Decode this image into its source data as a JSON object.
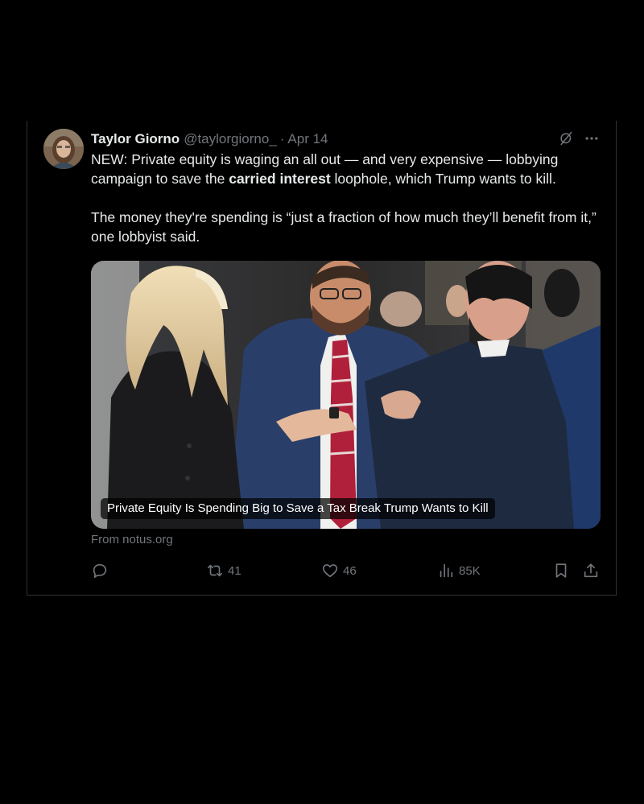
{
  "tweet": {
    "author": {
      "name": "Taylor Giorno",
      "handle": "@taylorgiorno_",
      "separator": "·",
      "date": "Apr 14"
    },
    "text": {
      "p1_a": "NEW: Private equity is waging an all out — and very expensive — lobbying campaign to save the ",
      "p1_bold": "carried interest",
      "p1_b": " loophole, which Trump wants to kill.",
      "p2": "The money they're spending is “just a fraction of how much they’ll benefit from it,” one lobbyist said."
    },
    "card": {
      "caption": "Private Equity Is Spending Big to Save a Tax Break Trump Wants to Kill",
      "source": "From notus.org"
    },
    "actions": {
      "reply_icon": "reply-icon",
      "retweet_icon": "retweet-icon",
      "retweets": "41",
      "like_icon": "heart-icon",
      "likes": "46",
      "views_icon": "views-icon",
      "views": "85K",
      "bookmark_icon": "bookmark-icon",
      "share_icon": "share-icon"
    },
    "header_icons": [
      "grok-icon",
      "more-icon"
    ]
  },
  "colors": {
    "background": "#000000",
    "text_primary": "#e7e9ea",
    "text_secondary": "#71767b",
    "border": "#2f3336"
  }
}
